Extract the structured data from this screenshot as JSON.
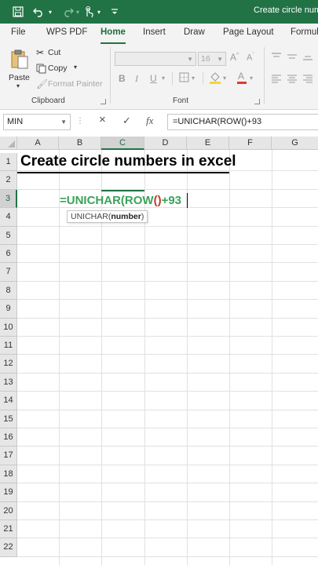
{
  "window": {
    "title": "Create circle numb"
  },
  "tabs": [
    {
      "label": "File"
    },
    {
      "label": "WPS PDF"
    },
    {
      "label": "Home"
    },
    {
      "label": "Insert"
    },
    {
      "label": "Draw"
    },
    {
      "label": "Page Layout"
    },
    {
      "label": "Formul"
    }
  ],
  "ribbon": {
    "clipboard": {
      "paste_label": "Paste",
      "cut_label": "Cut",
      "copy_label": "Copy",
      "format_painter_label": "Format Painter",
      "group_label": "Clipboard"
    },
    "font": {
      "font_name": "",
      "font_size": "16",
      "group_label": "Font",
      "bold": "B",
      "italic": "I",
      "underline": "U"
    }
  },
  "formula_bar": {
    "name_box": "MIN",
    "cancel_icon": "×",
    "enter_icon": "✓",
    "fx_label": "fx",
    "formula": "=UNICHAR(ROW()+93"
  },
  "sheet": {
    "columns": [
      "A",
      "B",
      "C",
      "D",
      "E",
      "F",
      "G"
    ],
    "rows": [
      "1",
      "2",
      "3",
      "4",
      "5",
      "6",
      "7",
      "8",
      "9",
      "10",
      "11",
      "12",
      "13",
      "14",
      "15",
      "16",
      "17",
      "18",
      "19",
      "20",
      "21",
      "22"
    ],
    "title_cell": "Create circle numbers in excel",
    "edit": {
      "part1": "=UNICHAR(ROW",
      "paren_open": "(",
      "paren_close": ")",
      "part2": "+93"
    },
    "tooltip": {
      "func": "UNICHAR(",
      "arg": "number",
      "close": ")"
    }
  }
}
